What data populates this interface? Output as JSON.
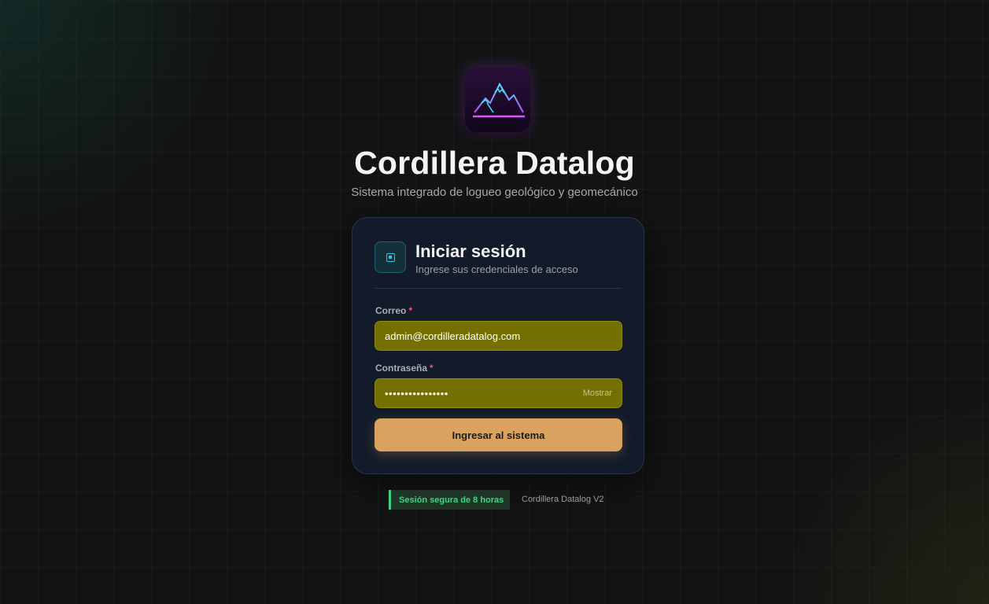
{
  "app": {
    "title": "Cordillera Datalog",
    "subtitle": "Sistema integrado de logueo geológico y geomecánico",
    "logo_icon": "mountain-neon-icon"
  },
  "login": {
    "title": "Iniciar sesión",
    "subtitle": "Ingrese sus credenciales de acceso",
    "email_label": "Correo",
    "email_value": "admin@cordilleradatalog.com",
    "password_label": "Contraseña",
    "password_dots": "••••••••••••••••",
    "show_label": "Mostrar",
    "required_mark": "*",
    "submit_label": "Ingresar al sistema"
  },
  "footer": {
    "session_badge": "Sesión segura de 8 horas",
    "version": "Cordillera Datalog V2"
  },
  "colors": {
    "accent": "#d9a260",
    "field_bg": "#747000",
    "badge_green": "#3fd47f",
    "card_bg": "#131b2a"
  }
}
